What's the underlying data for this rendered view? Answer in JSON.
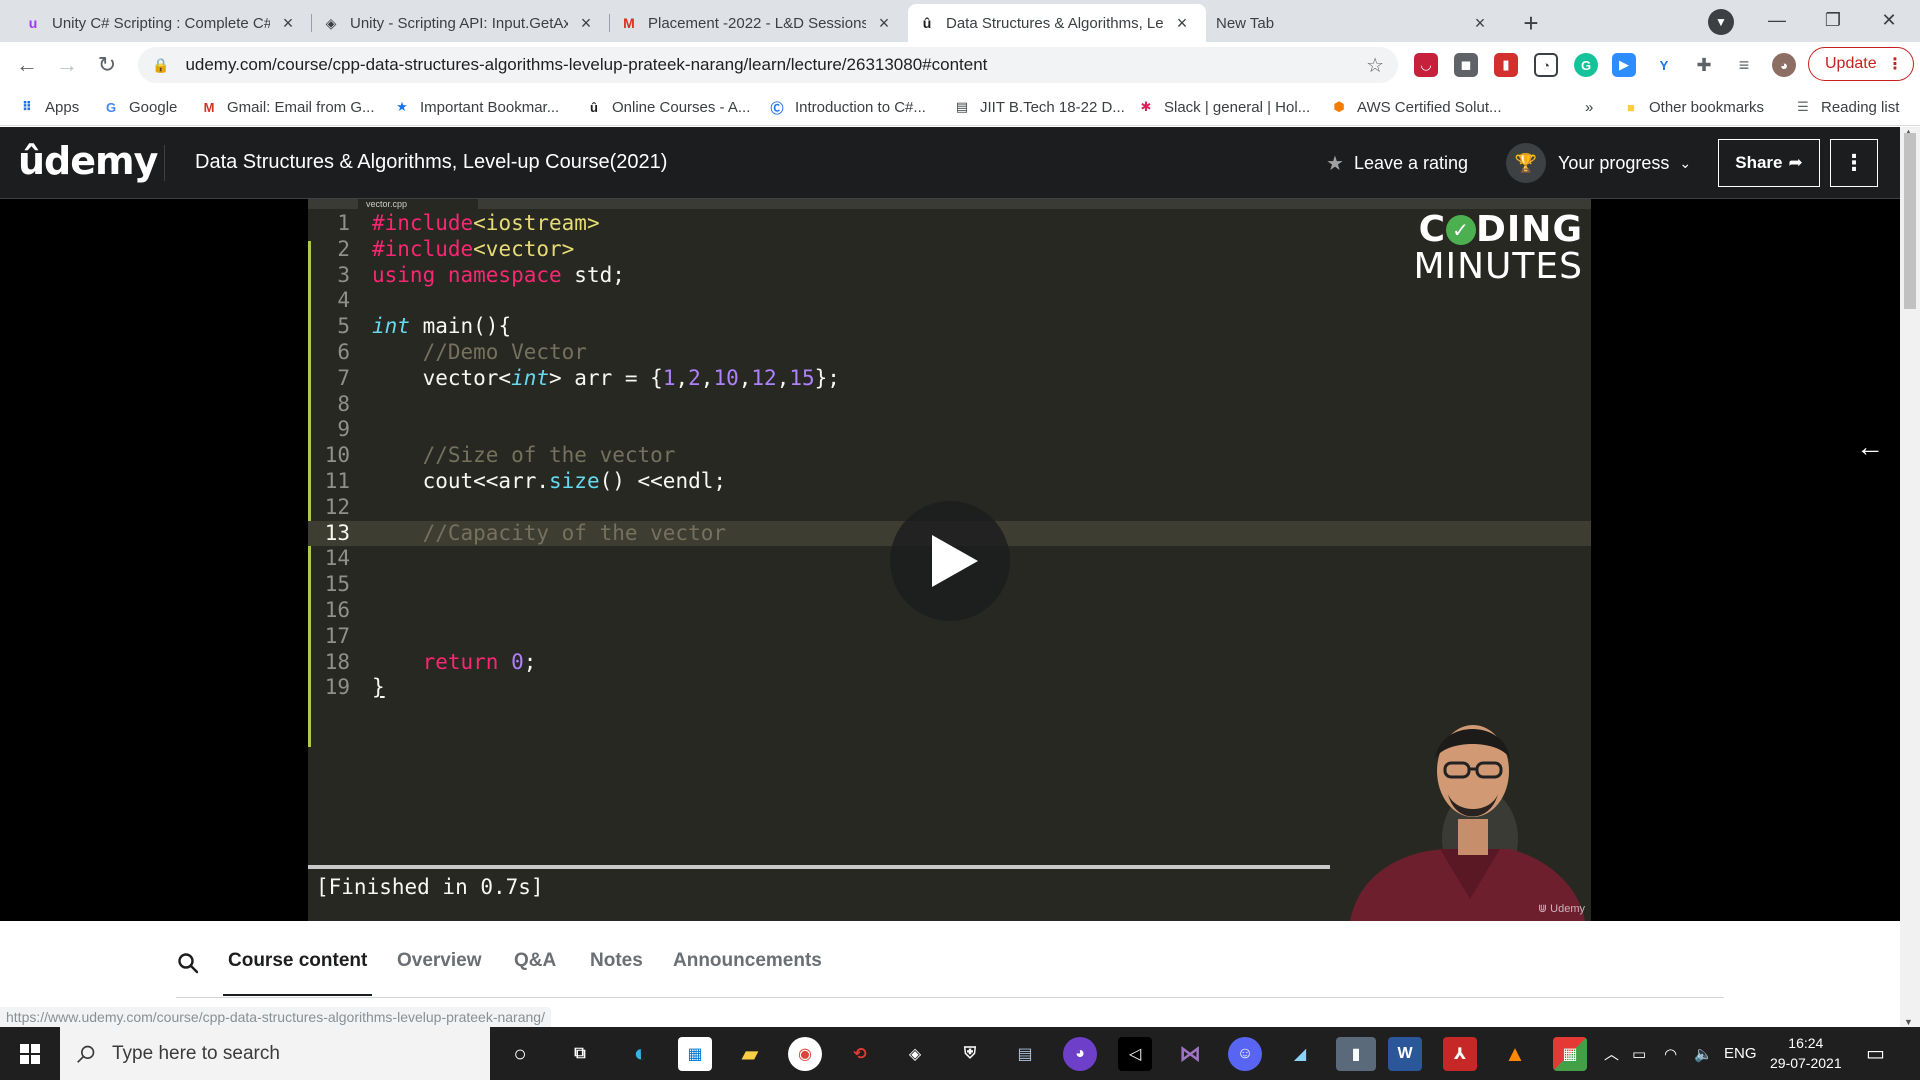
{
  "browser": {
    "tabs": [
      {
        "title": "Unity C# Scripting : Complete C#",
        "favicon": "udemy-icon",
        "color": "#a435f0"
      },
      {
        "title": "Unity - Scripting API: Input.GetAx",
        "favicon": "unity-icon",
        "color": "#3c4043"
      },
      {
        "title": "Placement -2022 - L&D Sessions",
        "favicon": "gmail-icon",
        "color": "#d93025"
      },
      {
        "title": "Data Structures & Algorithms, Le",
        "favicon": "udemy-icon",
        "color": "#1c1d1f"
      },
      {
        "title": "New Tab",
        "favicon": "",
        "color": ""
      }
    ],
    "url": "udemy.com/course/cpp-data-structures-algorithms-levelup-prateek-narang/learn/lecture/26313080#content",
    "update_label": "Update",
    "bookmarks": [
      {
        "label": "Apps"
      },
      {
        "label": "Google"
      },
      {
        "label": "Gmail: Email from G..."
      },
      {
        "label": "Important Bookmar..."
      },
      {
        "label": "Online Courses - A..."
      },
      {
        "label": "Introduction to C#..."
      },
      {
        "label": "JIIT B.Tech 18-22 D..."
      },
      {
        "label": "Slack | general | Hol..."
      },
      {
        "label": "AWS Certified Solut..."
      }
    ],
    "bookmarks_more": "»",
    "other_bookmarks": "Other bookmarks",
    "reading_list": "Reading list"
  },
  "udemy": {
    "logo": "ûdemy",
    "course_title": "Data Structures & Algorithms, Level-up Course(2021)",
    "leave_rating": "Leave a rating",
    "your_progress": "Your progress",
    "share": "Share"
  },
  "video": {
    "file_tab": "vector.cpp",
    "brand_line1_a": "C",
    "brand_line1_b": "DING",
    "brand_line2": "MINUTES",
    "console_output": "[Finished in 0.7s]",
    "watermark": "Udemy",
    "highlighted_line": 13,
    "code_lines": [
      "1",
      "2",
      "3",
      "4",
      "5",
      "6",
      "7",
      "8",
      "9",
      "10",
      "11",
      "12",
      "13",
      "14",
      "15",
      "16",
      "17",
      "18",
      "19"
    ]
  },
  "course_nav": {
    "tabs": [
      "Course content",
      "Overview",
      "Q&A",
      "Notes",
      "Announcements"
    ],
    "active": "Course content",
    "status_url": "https://www.udemy.com/course/cpp-data-structures-algorithms-levelup-prateek-narang/"
  },
  "taskbar": {
    "search_placeholder": "Type here to search",
    "language": "ENG",
    "time": "16:24",
    "date": "29-07-2021"
  }
}
